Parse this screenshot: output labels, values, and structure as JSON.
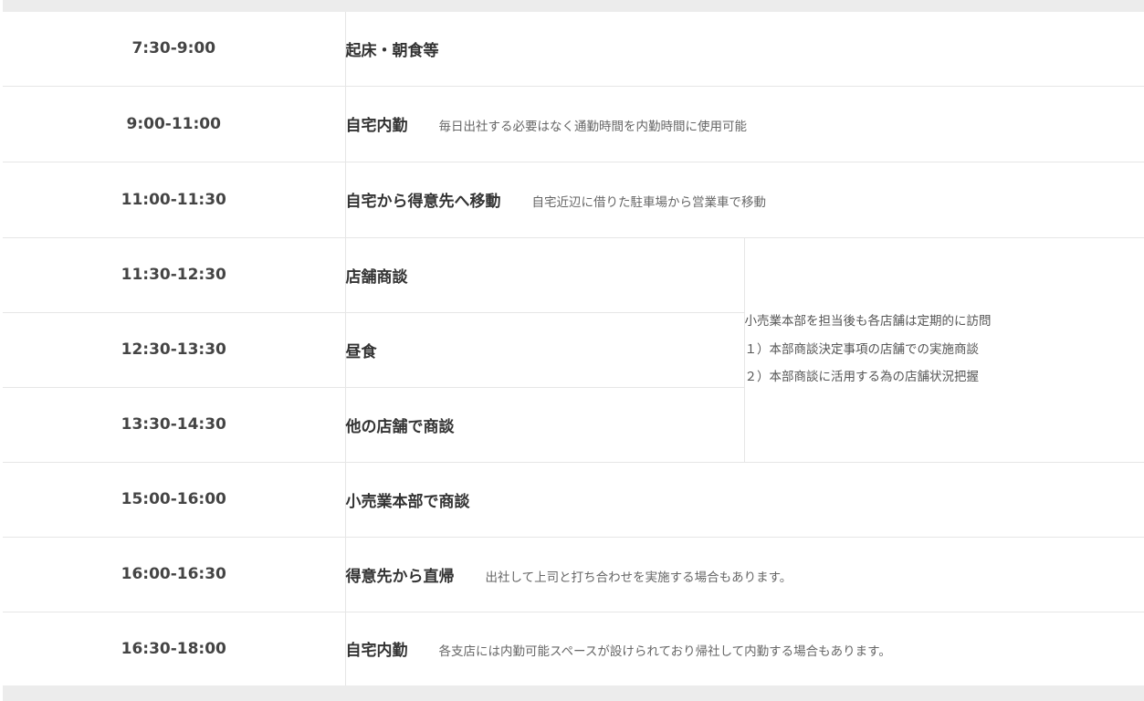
{
  "rows": [
    {
      "time": "7:30-9:00",
      "title": "起床・朝食等",
      "note": ""
    },
    {
      "time": "9:00-11:00",
      "title": "自宅内勤",
      "note": "毎日出社する必要はなく通勤時間を内勤時間に使用可能"
    },
    {
      "time": "11:00-11:30",
      "title": "自宅から得意先へ移動",
      "note": "自宅近辺に借りた駐車場から営業車で移動"
    },
    {
      "time": "11:30-12:30",
      "title": "店舗商談",
      "note": ""
    },
    {
      "time": "12:30-13:30",
      "title": "昼食",
      "note": ""
    },
    {
      "time": "13:30-14:30",
      "title": "他の店舗で商談",
      "note": ""
    },
    {
      "time": "15:00-16:00",
      "title": "小売業本部で商談",
      "note": ""
    },
    {
      "time": "16:00-16:30",
      "title": "得意先から直帰",
      "note": "出社して上司と打ち合わせを実施する場合もあります。"
    },
    {
      "time": "16:30-18:00",
      "title": "自宅内勤",
      "note": "各支店には内勤可能スペースが設けられており帰社して内勤する場合もあります。"
    }
  ],
  "merged_note": [
    "小売業本部を担当後も各店舗は定期的に訪問",
    "１）本部商談決定事項の店舗での実施商談",
    "２）本部商談に活用する為の店舗状況把握"
  ]
}
